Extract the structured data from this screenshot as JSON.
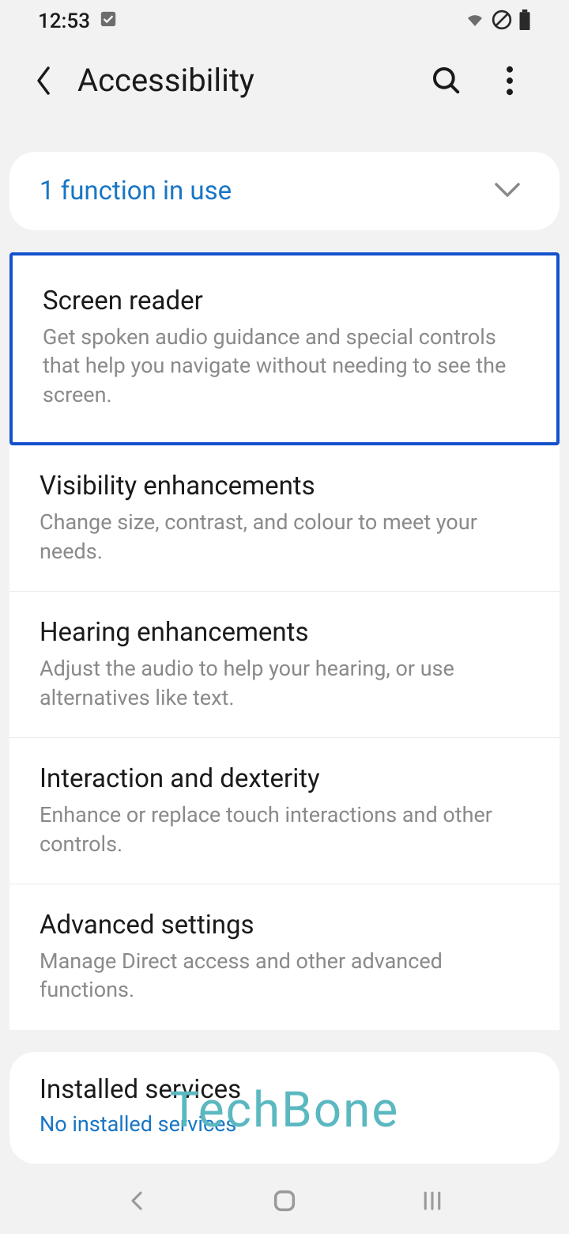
{
  "status": {
    "time": "12:53"
  },
  "appbar": {
    "title": "Accessibility"
  },
  "functionCard": {
    "label": "1 function in use"
  },
  "items": [
    {
      "title": "Screen reader",
      "description": "Get spoken audio guidance and special controls that help you navigate without needing to see the screen."
    },
    {
      "title": "Visibility enhancements",
      "description": "Change size, contrast, and colour to meet your needs."
    },
    {
      "title": "Hearing enhancements",
      "description": "Adjust the audio to help your hearing, or use alternatives like text."
    },
    {
      "title": "Interaction and dexterity",
      "description": "Enhance or replace touch interactions and other controls."
    },
    {
      "title": "Advanced settings",
      "description": "Manage Direct access and other advanced functions."
    }
  ],
  "installedServices": {
    "title": "Installed services",
    "subtitle": "No installed services"
  },
  "watermark": "TechBone"
}
